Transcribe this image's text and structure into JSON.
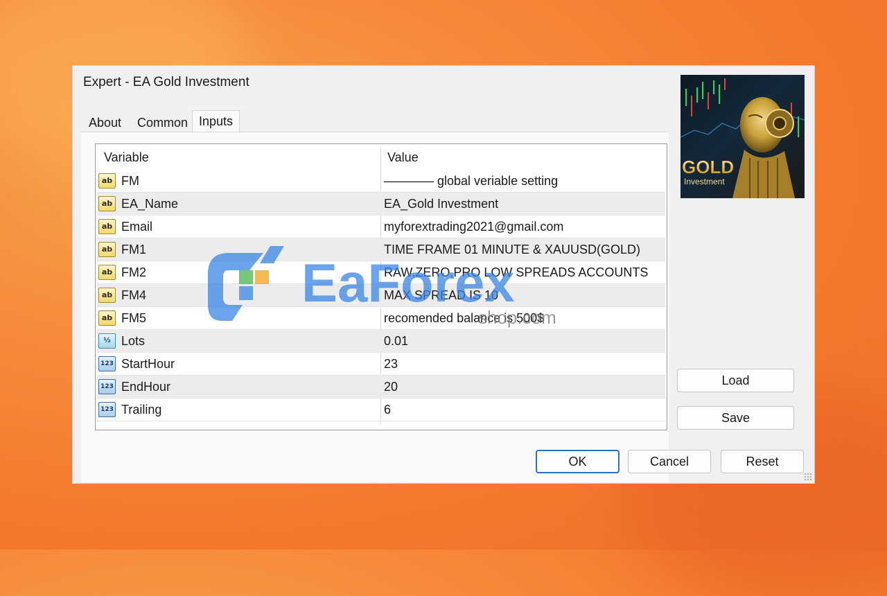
{
  "dialog": {
    "title": "Expert - EA Gold Investment",
    "tabs": [
      {
        "label": "About"
      },
      {
        "label": "Common"
      },
      {
        "label": "Inputs"
      }
    ],
    "active_tab": "Inputs"
  },
  "table": {
    "headers": {
      "variable": "Variable",
      "value": "Value"
    },
    "rows": [
      {
        "icon": "ab",
        "icon_name": "string-type-icon",
        "variable": "FM",
        "value": "———— global veriable setting"
      },
      {
        "icon": "ab",
        "icon_name": "string-type-icon",
        "variable": "EA_Name",
        "value": "EA_Gold Investment"
      },
      {
        "icon": "ab",
        "icon_name": "string-type-icon",
        "variable": "Email",
        "value": "myforextrading2021@gmail.com"
      },
      {
        "icon": "ab",
        "icon_name": "string-type-icon",
        "variable": "FM1",
        "value": "TIME FRAME 01 MINUTE & XAUUSD(GOLD)"
      },
      {
        "icon": "ab",
        "icon_name": "string-type-icon",
        "variable": "FM2",
        "value": "RAW,ZERO,PRO LOW SPREADS ACCOUNTS"
      },
      {
        "icon": "ab",
        "icon_name": "string-type-icon",
        "variable": "FM4",
        "value": " MAX SPREAD IS 10"
      },
      {
        "icon": "ab",
        "icon_name": "string-type-icon",
        "variable": "FM5",
        "value": " recomended balance is 500$"
      },
      {
        "icon": "½",
        "icon_name": "double-type-icon",
        "variable": "Lots",
        "value": "0.01"
      },
      {
        "icon": "123",
        "icon_name": "integer-type-icon",
        "variable": "StartHour",
        "value": "23"
      },
      {
        "icon": "123",
        "icon_name": "integer-type-icon",
        "variable": "EndHour",
        "value": "20"
      },
      {
        "icon": "123",
        "icon_name": "integer-type-icon",
        "variable": "Trailing",
        "value": "6"
      }
    ]
  },
  "thumbnail": {
    "text_line1": "GOLD",
    "text_line2": "Investment"
  },
  "buttons": {
    "load": "Load",
    "save": "Save",
    "ok": "OK",
    "cancel": "Cancel",
    "reset": "Reset"
  },
  "watermark": {
    "brand": "EaForex",
    "domain": "shop.com"
  },
  "colors": {
    "background_orange": "#f37a2d",
    "dialog_bg": "#f0f0f0",
    "primary_button_border": "#2f6fbf",
    "gold": "#c9a23a"
  }
}
